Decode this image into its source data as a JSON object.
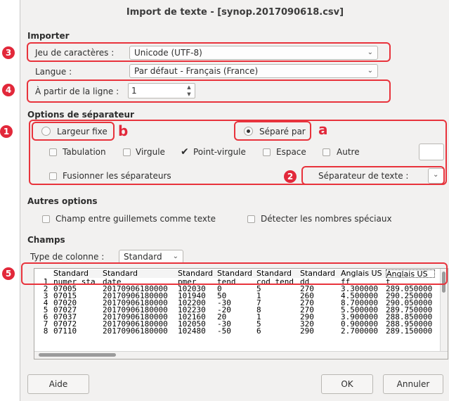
{
  "window": {
    "title": "Import de texte - [synop.2017090618.csv]"
  },
  "importer": {
    "section": "Importer",
    "charset_label": "Jeu de caractères :",
    "charset_value": "Unicode (UTF-8)",
    "language_label": "Langue :",
    "language_value": "Par défaut - Français (France)",
    "from_line_label": "À partir de la ligne :",
    "from_line_value": "1"
  },
  "separator": {
    "section": "Options de séparateur",
    "fixed_width": "Largeur fixe",
    "separated_by": "Séparé par",
    "tab": "Tabulation",
    "comma": "Virgule",
    "semicolon": "Point-virgule",
    "space": "Espace",
    "other": "Autre",
    "merge": "Fusionner les séparateurs",
    "text_sep_label": "Séparateur de texte :",
    "selected_mode": "separated",
    "semicolon_checked": true
  },
  "other_options": {
    "section": "Autres options",
    "quoted_as_text": "Champ entre guillemets comme texte",
    "detect_special": "Détecter les nombres spéciaux"
  },
  "fields": {
    "section": "Champs",
    "column_type_label": "Type de colonne :",
    "column_type_value": "Standard"
  },
  "preview": {
    "headers": [
      "Standard",
      "Standard",
      "Standard",
      "Standard",
      "Standard",
      "Standard",
      "Anglais US",
      "Anglais US"
    ],
    "rows": [
      {
        "n": "1",
        "cells": [
          "numer_sta",
          "date",
          "pmer",
          "tend",
          "cod_tend",
          "dd",
          "ff",
          "t"
        ]
      },
      {
        "n": "2",
        "cells": [
          "07005",
          "20170906180000",
          "102030",
          "0",
          "5",
          "270",
          "3.300000",
          "289.050000"
        ]
      },
      {
        "n": "3",
        "cells": [
          "07015",
          "20170906180000",
          "101940",
          "50",
          "1",
          "260",
          "4.500000",
          "290.250000"
        ]
      },
      {
        "n": "4",
        "cells": [
          "07020",
          "20170906180000",
          "102200",
          "-30",
          "7",
          "270",
          "8.700000",
          "290.050000"
        ]
      },
      {
        "n": "5",
        "cells": [
          "07027",
          "20170906180000",
          "102230",
          "-20",
          "8",
          "270",
          "5.500000",
          "289.750000"
        ]
      },
      {
        "n": "6",
        "cells": [
          "07037",
          "20170906180000",
          "102160",
          "20",
          "1",
          "290",
          "3.900000",
          "288.850000"
        ]
      },
      {
        "n": "7",
        "cells": [
          "07072",
          "20170906180000",
          "102050",
          "-30",
          "5",
          "320",
          "0.900000",
          "288.950000"
        ]
      },
      {
        "n": "8",
        "cells": [
          "07110",
          "20170906180000",
          "102480",
          "-50",
          "6",
          "290",
          "2.700000",
          "289.150000"
        ]
      }
    ]
  },
  "buttons": {
    "help": "Aide",
    "ok": "OK",
    "cancel": "Annuler"
  },
  "annotations": {
    "b1": "1",
    "b2": "2",
    "b3": "3",
    "b4": "4",
    "b5": "5",
    "la": "a",
    "lb": "b"
  },
  "colors": {
    "annotation_red": "#e2283a",
    "window_bg": "#f2f1f0"
  }
}
